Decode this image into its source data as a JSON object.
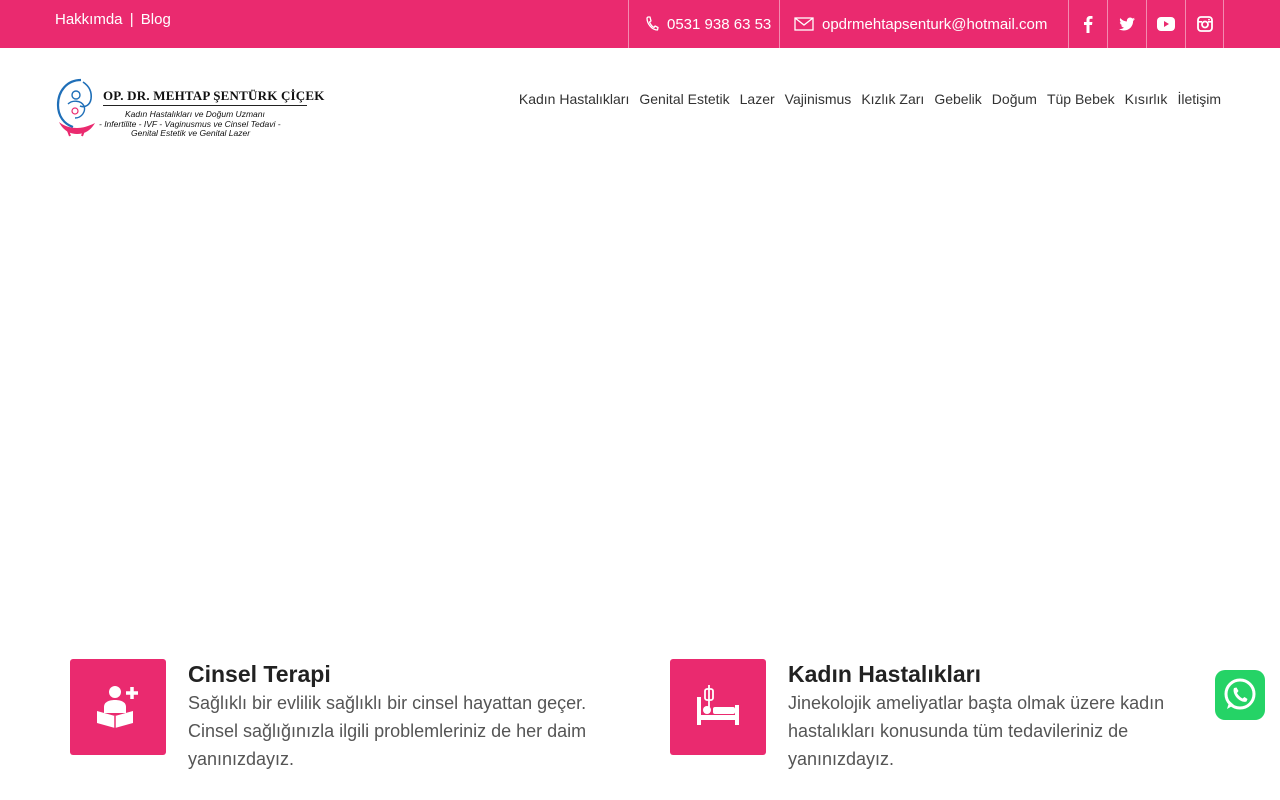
{
  "topbar": {
    "links": [
      "Hakkımda",
      "Blog"
    ],
    "separator": "|",
    "phone": "0531 938 63 53",
    "email": "opdrmehtapsenturk@hotmail.com",
    "social": [
      "facebook-icon",
      "twitter-icon",
      "youtube-icon",
      "instagram-icon"
    ],
    "color": "#ea2a6f"
  },
  "logo": {
    "title": "OP. DR. MEHTAP ŞENTÜRK ÇİÇEK",
    "line1": "Kadın Hastalıkları ve Doğum Uzmanı",
    "line2": "- Infertilite - IVF - Vaginusmus ve Cinsel Tedavi -",
    "line3": "Genital Estetik ve Genital Lazer"
  },
  "nav": [
    "Kadın Hastalıkları",
    "Genital Estetik",
    "Lazer",
    "Vajinismus",
    "Kızlık Zarı",
    "Gebelik",
    "Doğum",
    "Tüp Bebek",
    "Kısırlık",
    "İletişim"
  ],
  "features": [
    {
      "title": "Cinsel Terapi",
      "text": "Sağlıklı bir evlilik sağlıklı bir cinsel hayattan geçer. Cinsel sağlığınızla ilgili problemleriniz de her daim yanınızdayız.",
      "icon": "reading-person-icon"
    },
    {
      "title": "Kadın Hastalıkları",
      "text": "Jinekolojik ameliyatlar başta olmak üzere kadın hastalıkları konusunda tüm tedavileriniz de yanınızdayız.",
      "icon": "hospital-bed-icon"
    }
  ],
  "whatsapp": {
    "icon": "whatsapp-icon",
    "color": "#25d366"
  }
}
